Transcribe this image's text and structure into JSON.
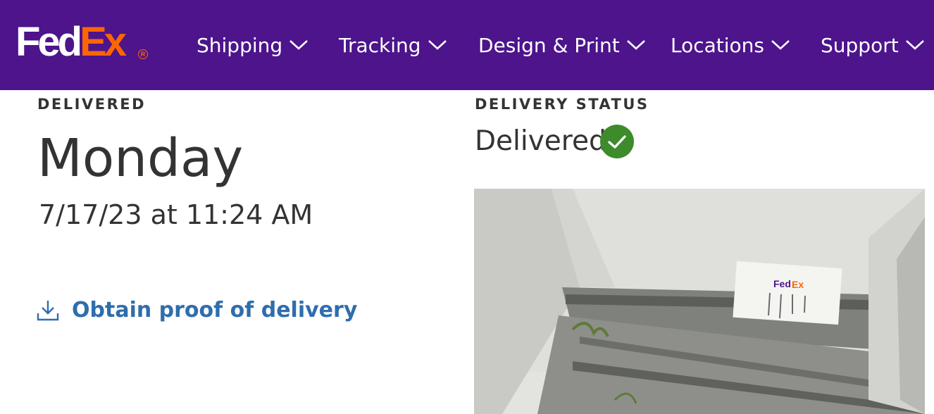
{
  "brand": {
    "logo_fed": "Fed",
    "logo_ex": "Ex",
    "logo_reg": "R",
    "colors": {
      "purple": "#4d148c",
      "orange": "#ff6600"
    }
  },
  "nav": {
    "items": [
      {
        "label": "Shipping"
      },
      {
        "label": "Tracking"
      },
      {
        "label": "Design & Print"
      },
      {
        "label": "Locations"
      },
      {
        "label": "Support"
      }
    ]
  },
  "delivered": {
    "label": "DELIVERED",
    "day": "Monday",
    "datetime": "7/17/23 at 11:24 AM",
    "proof_link": "Obtain proof of delivery"
  },
  "status": {
    "label": "DELIVERY STATUS",
    "value": "Delivered",
    "icon": "check-circle-icon",
    "icon_color": "#3d8b2b"
  },
  "photo": {
    "description_icon": "delivery-photo",
    "sign_text": "FedEx"
  },
  "link_color": "#2f6dad"
}
